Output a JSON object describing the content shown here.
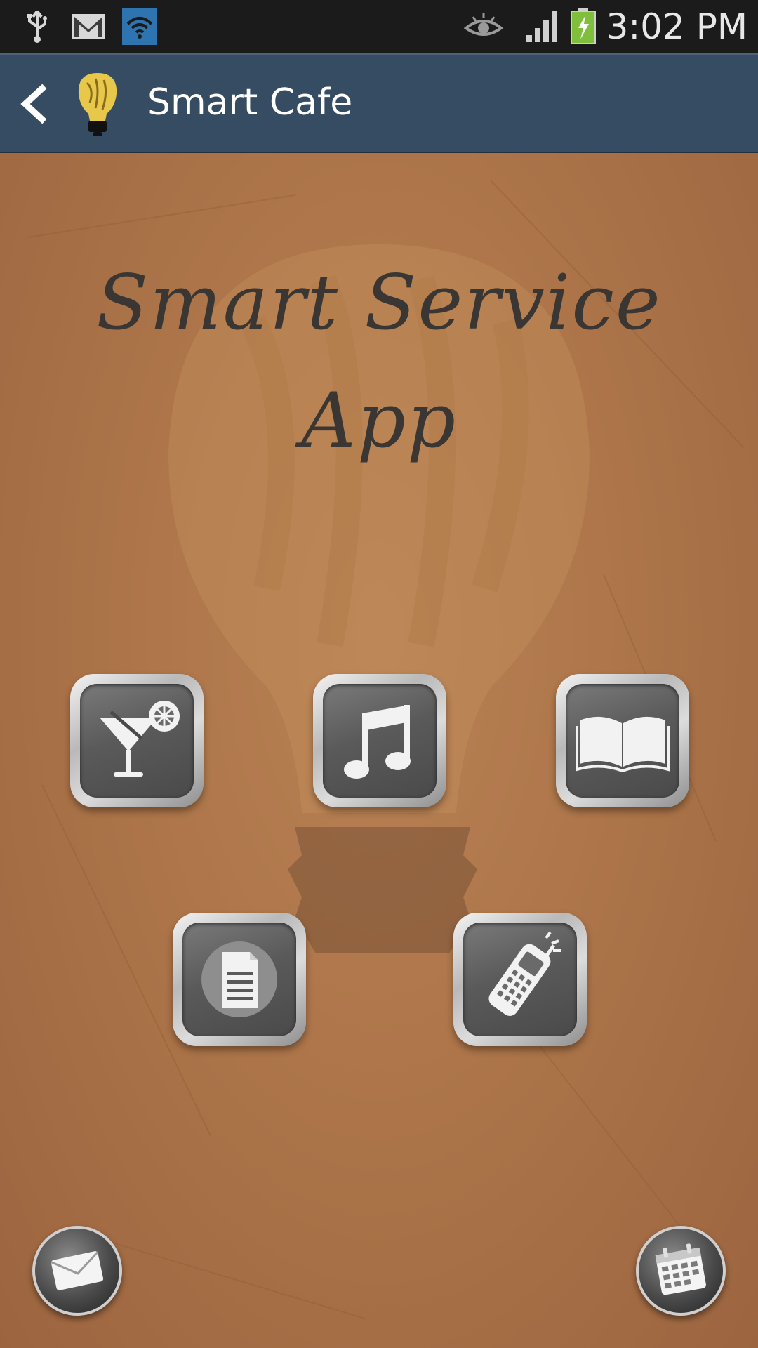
{
  "status_bar": {
    "time": "3:02 PM",
    "icons": [
      "usb-icon",
      "gmail-icon",
      "wifi-icon",
      "eye-icon",
      "signal-icon",
      "battery-charging-icon"
    ]
  },
  "action_bar": {
    "title": "Smart Cafe",
    "back_icon": "chevron-left-icon",
    "logo_icon": "smart-bulb-logo",
    "color": "#354c62"
  },
  "main": {
    "headline_line1": "Smart Service",
    "headline_line2": "App",
    "tiles": [
      {
        "icon": "cocktail-icon"
      },
      {
        "icon": "music-note-icon"
      },
      {
        "icon": "open-book-icon"
      },
      {
        "icon": "document-icon"
      },
      {
        "icon": "mobile-phone-icon"
      }
    ],
    "bottom_buttons": [
      {
        "icon": "envelope-icon"
      },
      {
        "icon": "calendar-icon"
      }
    ],
    "background_color": "#a8714a"
  }
}
